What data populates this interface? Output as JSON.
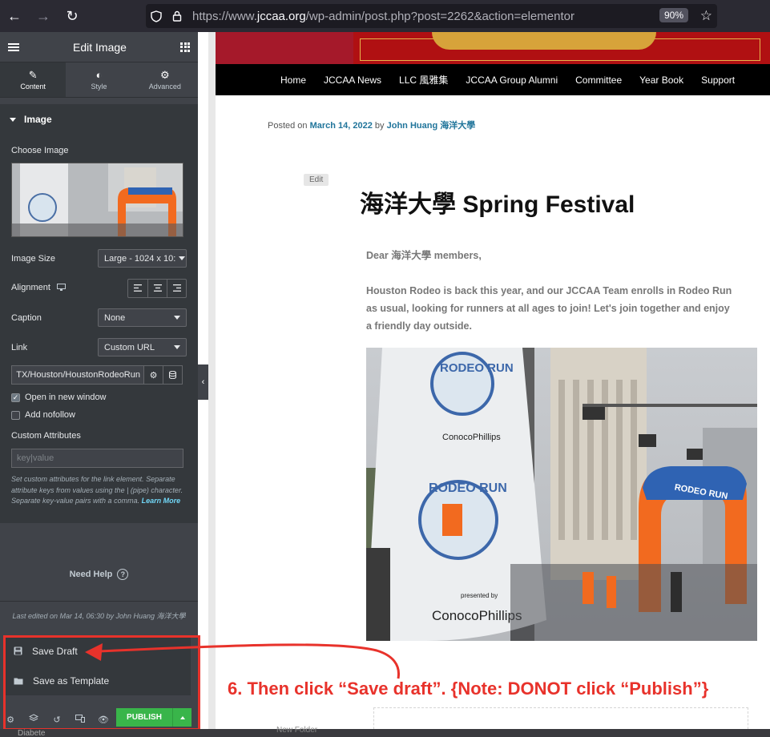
{
  "browser": {
    "url_prefix": "https://www.",
    "url_domain": "jccaa.org",
    "url_path": "/wp-admin/post.php?post=2262&action=elementor",
    "zoom": "90%"
  },
  "panel": {
    "title": "Edit Image",
    "tabs": [
      {
        "label": "Content",
        "icon": "pencil-icon"
      },
      {
        "label": "Style",
        "icon": "contrast-icon"
      },
      {
        "label": "Advanced",
        "icon": "gear-icon"
      }
    ],
    "section": "Image",
    "choose_image": "Choose Image",
    "image_size_label": "Image Size",
    "image_size_value": "Large - 1024 x 10:",
    "alignment_label": "Alignment",
    "caption_label": "Caption",
    "caption_value": "None",
    "link_label": "Link",
    "link_value": "Custom URL",
    "link_url": "TX/Houston/HoustonRodeoRun",
    "open_new_window": "Open in new window",
    "add_nofollow": "Add nofollow",
    "custom_attributes_label": "Custom Attributes",
    "custom_attributes_placeholder": "key|value",
    "help_text": "Set custom attributes for the link element. Separate attribute keys from values using the | (pipe) character. Separate key-value pairs with a comma.",
    "learn_more": "Learn More",
    "need_help": "Need Help",
    "last_edited": "Last edited on Mar 14, 06:30 by John Huang 海洋大學",
    "save_draft": "Save Draft",
    "save_as_template": "Save as Template",
    "publish": "PUBLISH"
  },
  "site": {
    "menu": [
      "Home",
      "JCCAA News",
      "LLC 風雅集",
      "JCCAA Group Alumni",
      "Committee",
      "Year Book",
      "Support"
    ],
    "posted_on": "Posted on ",
    "date": "March 14, 2022",
    "by": " by ",
    "author": "John Huang 海洋大學",
    "edit": "Edit",
    "title": "海洋大學 Spring Festival",
    "greeting": "Dear 海洋大學 members,",
    "paragraph": "Houston Rodeo is back this year, and our JCCAA Team enrolls in Rodeo Run as usual, looking for runners at all ages to join! Let's join together and enjoy a friendly day outside."
  },
  "photo_text": {
    "banner_upper": "RODEO RUN",
    "presented": "presented by",
    "brand": "ConocoPhillips",
    "arch_sign": "RODEO RUN"
  },
  "annotation": {
    "text": "6. Then click “Save draft”.  {Note: DONOT click “Publish”}",
    "color": "#e8322b"
  },
  "bottom": {
    "left": "Diabete",
    "right": "New Folder"
  },
  "colors": {
    "panel_bg": "#404349",
    "publish_green": "#39b54a",
    "link_blue": "#21759b"
  }
}
